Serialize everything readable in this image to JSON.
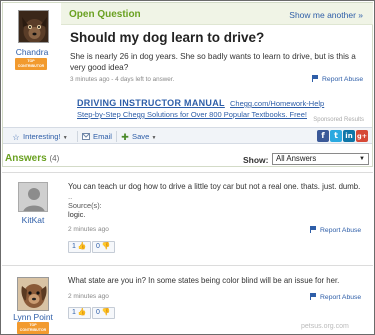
{
  "question": {
    "header_label": "Open Question",
    "show_me_link": "Show me another »",
    "asker_name": "Chandra",
    "asker_badge": "TOP CONTRIBUTOR",
    "title": "Should my dog learn to drive?",
    "body": "She is nearly 26 in dog years. She so badly wants to learn to drive, but is this a very good idea?",
    "meta": "3 minutes ago - 4 days left to answer.",
    "report_label": "Report Abuse"
  },
  "ad": {
    "title": "DRIVING INSTRUCTOR MANUAL",
    "url": "Chegg.com/Homework-Help",
    "line2": "Step-by-Step Chegg Solutions for Over 800 Popular Textbooks. Free!",
    "sponsored": "Sponsored Results"
  },
  "toolbar": {
    "interesting": "Interesting!",
    "email": "Email",
    "save": "Save",
    "social": [
      "f",
      "t",
      "in",
      "g+"
    ],
    "social_colors": [
      "#3b5998",
      "#2aa9e0",
      "#0e76a8",
      "#d64937"
    ]
  },
  "answers": {
    "heading": "Answers",
    "count": "(4)",
    "show_label": "Show:",
    "filter_value": "All Answers",
    "items": [
      {
        "user": "KitKat",
        "text": "You can teach ur dog how to drive a little toy car but not a real one. thats. just. dumb.",
        "dots": "..",
        "source_label": "Source(s):",
        "source": "logic.",
        "time": "2 minutes ago",
        "report": "Report Abuse",
        "thumbs_up": "1",
        "thumbs_down": "0"
      },
      {
        "user": "Lynn Point",
        "badge": "TOP CONTRIBUTOR",
        "text": "What state are you in? In some states being color blind will be an issue for her.",
        "time": "2 minutes ago",
        "report": "Report Abuse",
        "thumbs_up": "1",
        "thumbs_down": "0"
      }
    ]
  },
  "colors": {
    "accent_green": "#6aa121",
    "link_blue": "#2e5ea8",
    "badge_orange": "#f29a2e"
  },
  "watermark": "petsus.org.com"
}
